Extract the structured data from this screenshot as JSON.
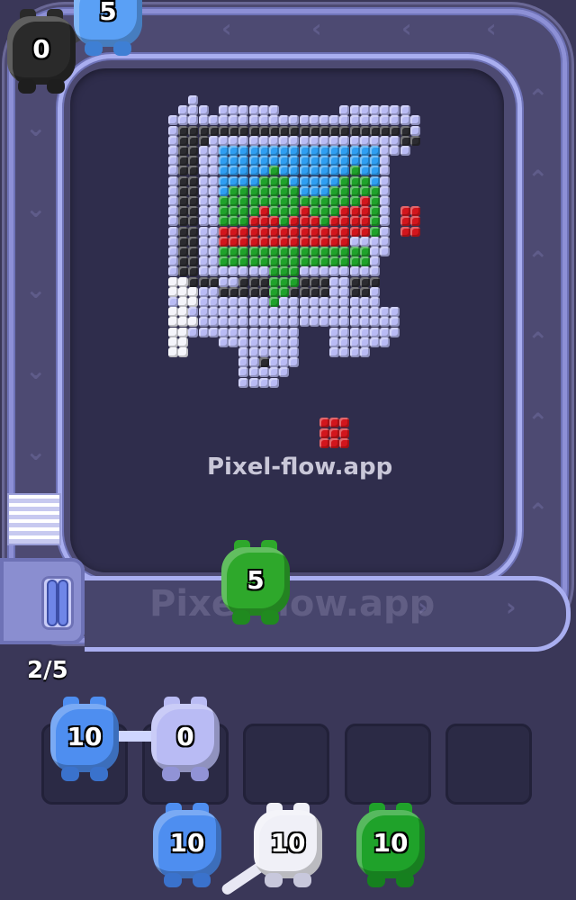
{
  "watermark_text": "Pixel-flow.app",
  "progress": {
    "label": "2/5"
  },
  "track_pigs": [
    {
      "name": "black-pig",
      "value": "0",
      "color": "#2a2a2a"
    },
    {
      "name": "blue-pig-top",
      "value": "5",
      "color": "#5aa0f5"
    },
    {
      "name": "green-pig",
      "value": "5",
      "color": "#2ea82b"
    }
  ],
  "queue_pigs": [
    {
      "name": "queue-blue-pig",
      "value": "10",
      "color": "#4e8ef0"
    },
    {
      "name": "queue-lavender-pig",
      "value": "0",
      "color": "#b9bbf4"
    }
  ],
  "reserve_pigs": [
    {
      "name": "reserve-blue-pig",
      "value": "10",
      "color": "#4e8ef0"
    },
    {
      "name": "reserve-white-pig",
      "value": "10",
      "color": "#f0f0f7"
    },
    {
      "name": "reserve-green-pig",
      "value": "10",
      "color": "#1fa22a"
    }
  ],
  "colors": {
    "lavender": "#b9bbf4",
    "dark": "#2b2b30",
    "sky": "#2e9ef2",
    "green": "#1fa22a",
    "red": "#d2151c",
    "white": "#f5f5fb"
  }
}
